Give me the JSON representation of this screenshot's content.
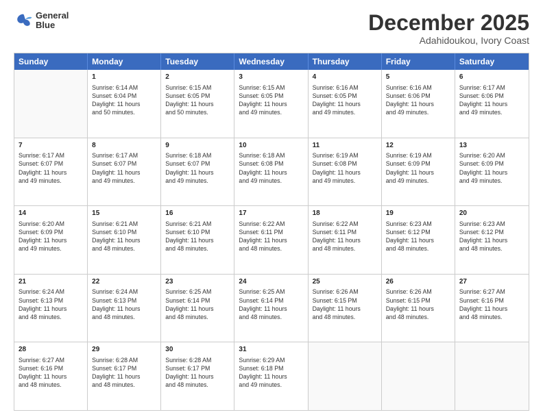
{
  "header": {
    "logo_line1": "General",
    "logo_line2": "Blue",
    "title": "December 2025",
    "subtitle": "Adahidoukou, Ivory Coast"
  },
  "calendar": {
    "days_of_week": [
      "Sunday",
      "Monday",
      "Tuesday",
      "Wednesday",
      "Thursday",
      "Friday",
      "Saturday"
    ],
    "weeks": [
      [
        {
          "day": "",
          "info": ""
        },
        {
          "day": "1",
          "info": "Sunrise: 6:14 AM\nSunset: 6:04 PM\nDaylight: 11 hours\nand 50 minutes."
        },
        {
          "day": "2",
          "info": "Sunrise: 6:15 AM\nSunset: 6:05 PM\nDaylight: 11 hours\nand 50 minutes."
        },
        {
          "day": "3",
          "info": "Sunrise: 6:15 AM\nSunset: 6:05 PM\nDaylight: 11 hours\nand 49 minutes."
        },
        {
          "day": "4",
          "info": "Sunrise: 6:16 AM\nSunset: 6:05 PM\nDaylight: 11 hours\nand 49 minutes."
        },
        {
          "day": "5",
          "info": "Sunrise: 6:16 AM\nSunset: 6:06 PM\nDaylight: 11 hours\nand 49 minutes."
        },
        {
          "day": "6",
          "info": "Sunrise: 6:17 AM\nSunset: 6:06 PM\nDaylight: 11 hours\nand 49 minutes."
        }
      ],
      [
        {
          "day": "7",
          "info": "Sunrise: 6:17 AM\nSunset: 6:07 PM\nDaylight: 11 hours\nand 49 minutes."
        },
        {
          "day": "8",
          "info": "Sunrise: 6:17 AM\nSunset: 6:07 PM\nDaylight: 11 hours\nand 49 minutes."
        },
        {
          "day": "9",
          "info": "Sunrise: 6:18 AM\nSunset: 6:07 PM\nDaylight: 11 hours\nand 49 minutes."
        },
        {
          "day": "10",
          "info": "Sunrise: 6:18 AM\nSunset: 6:08 PM\nDaylight: 11 hours\nand 49 minutes."
        },
        {
          "day": "11",
          "info": "Sunrise: 6:19 AM\nSunset: 6:08 PM\nDaylight: 11 hours\nand 49 minutes."
        },
        {
          "day": "12",
          "info": "Sunrise: 6:19 AM\nSunset: 6:09 PM\nDaylight: 11 hours\nand 49 minutes."
        },
        {
          "day": "13",
          "info": "Sunrise: 6:20 AM\nSunset: 6:09 PM\nDaylight: 11 hours\nand 49 minutes."
        }
      ],
      [
        {
          "day": "14",
          "info": "Sunrise: 6:20 AM\nSunset: 6:09 PM\nDaylight: 11 hours\nand 49 minutes."
        },
        {
          "day": "15",
          "info": "Sunrise: 6:21 AM\nSunset: 6:10 PM\nDaylight: 11 hours\nand 48 minutes."
        },
        {
          "day": "16",
          "info": "Sunrise: 6:21 AM\nSunset: 6:10 PM\nDaylight: 11 hours\nand 48 minutes."
        },
        {
          "day": "17",
          "info": "Sunrise: 6:22 AM\nSunset: 6:11 PM\nDaylight: 11 hours\nand 48 minutes."
        },
        {
          "day": "18",
          "info": "Sunrise: 6:22 AM\nSunset: 6:11 PM\nDaylight: 11 hours\nand 48 minutes."
        },
        {
          "day": "19",
          "info": "Sunrise: 6:23 AM\nSunset: 6:12 PM\nDaylight: 11 hours\nand 48 minutes."
        },
        {
          "day": "20",
          "info": "Sunrise: 6:23 AM\nSunset: 6:12 PM\nDaylight: 11 hours\nand 48 minutes."
        }
      ],
      [
        {
          "day": "21",
          "info": "Sunrise: 6:24 AM\nSunset: 6:13 PM\nDaylight: 11 hours\nand 48 minutes."
        },
        {
          "day": "22",
          "info": "Sunrise: 6:24 AM\nSunset: 6:13 PM\nDaylight: 11 hours\nand 48 minutes."
        },
        {
          "day": "23",
          "info": "Sunrise: 6:25 AM\nSunset: 6:14 PM\nDaylight: 11 hours\nand 48 minutes."
        },
        {
          "day": "24",
          "info": "Sunrise: 6:25 AM\nSunset: 6:14 PM\nDaylight: 11 hours\nand 48 minutes."
        },
        {
          "day": "25",
          "info": "Sunrise: 6:26 AM\nSunset: 6:15 PM\nDaylight: 11 hours\nand 48 minutes."
        },
        {
          "day": "26",
          "info": "Sunrise: 6:26 AM\nSunset: 6:15 PM\nDaylight: 11 hours\nand 48 minutes."
        },
        {
          "day": "27",
          "info": "Sunrise: 6:27 AM\nSunset: 6:16 PM\nDaylight: 11 hours\nand 48 minutes."
        }
      ],
      [
        {
          "day": "28",
          "info": "Sunrise: 6:27 AM\nSunset: 6:16 PM\nDaylight: 11 hours\nand 48 minutes."
        },
        {
          "day": "29",
          "info": "Sunrise: 6:28 AM\nSunset: 6:17 PM\nDaylight: 11 hours\nand 48 minutes."
        },
        {
          "day": "30",
          "info": "Sunrise: 6:28 AM\nSunset: 6:17 PM\nDaylight: 11 hours\nand 48 minutes."
        },
        {
          "day": "31",
          "info": "Sunrise: 6:29 AM\nSunset: 6:18 PM\nDaylight: 11 hours\nand 49 minutes."
        },
        {
          "day": "",
          "info": ""
        },
        {
          "day": "",
          "info": ""
        },
        {
          "day": "",
          "info": ""
        }
      ]
    ]
  }
}
